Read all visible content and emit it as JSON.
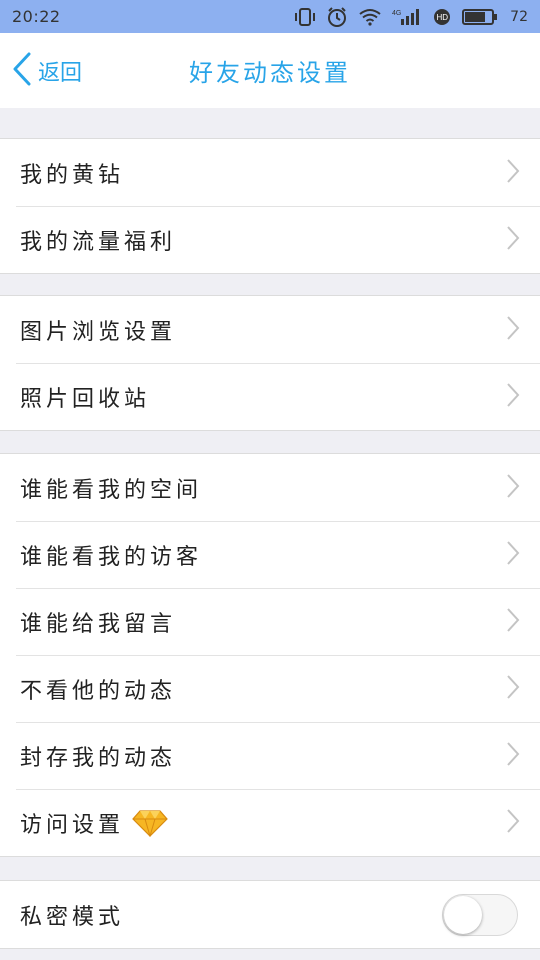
{
  "status_bar": {
    "time": "20:22",
    "battery_level": "72",
    "network_label": "4G",
    "icons": [
      "vibrate-icon",
      "alarm-icon",
      "wifi-icon",
      "signal-icon",
      "hd-icon",
      "battery-icon"
    ]
  },
  "nav": {
    "back_label": "返回",
    "title": "好友动态设置"
  },
  "groups": [
    {
      "items": [
        {
          "label": "我的黄钻"
        },
        {
          "label": "我的流量福利"
        }
      ]
    },
    {
      "items": [
        {
          "label": "图片浏览设置"
        },
        {
          "label": "照片回收站"
        }
      ]
    },
    {
      "items": [
        {
          "label": "谁能看我的空间"
        },
        {
          "label": "谁能看我的访客"
        },
        {
          "label": "谁能给我留言"
        },
        {
          "label": "不看他的动态"
        },
        {
          "label": "封存我的动态"
        },
        {
          "label": "访问设置",
          "badge_icon": "diamond-icon"
        }
      ]
    },
    {
      "items": [
        {
          "label": "私密模式",
          "toggle": false
        }
      ]
    }
  ],
  "colors": {
    "status_bar_bg": "#8db0f0",
    "accent": "#28a4e8",
    "page_bg": "#efeff4"
  }
}
